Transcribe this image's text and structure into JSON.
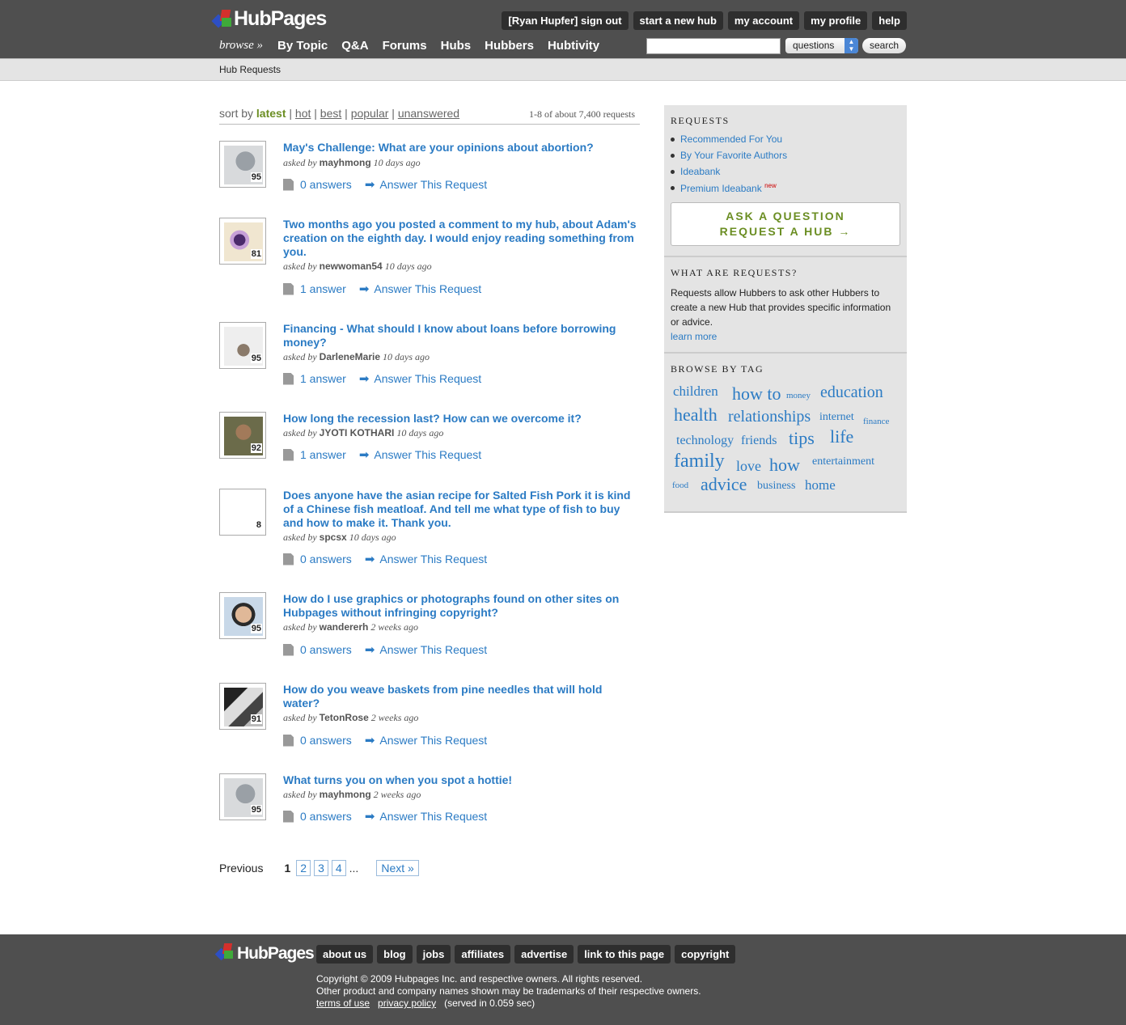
{
  "header": {
    "logo_text": "HubPages",
    "user_nav": [
      "[Ryan Hupfer] sign out",
      "start a new hub",
      "my account",
      "my profile",
      "help"
    ],
    "browse_label": "browse »",
    "main_nav": [
      "By Topic",
      "Q&A",
      "Forums",
      "Hubs",
      "Hubbers",
      "Hubtivity"
    ],
    "search": {
      "value": "",
      "select_value": "questions",
      "button_label": "search"
    }
  },
  "breadcrumb": "Hub Requests",
  "sort": {
    "prefix": "sort by",
    "current": "latest",
    "options": [
      "hot",
      "best",
      "popular",
      "unanswered"
    ],
    "count": "1-8 of about 7,400 requests"
  },
  "requests": [
    {
      "title": "May's Challenge: What are your opinions about abortion?",
      "asked_prefix": "asked by",
      "author": "mayhmong",
      "time": "10 days ago",
      "score": "95",
      "answers": "0 answers",
      "action": "Answer This Request"
    },
    {
      "title": "Two months ago you posted a comment to my hub, about Adam's creation on the eighth day. I would enjoy reading something from you.",
      "asked_prefix": "asked by",
      "author": "newwoman54",
      "time": "10 days ago",
      "score": "81",
      "answers": "1 answer",
      "action": "Answer This Request"
    },
    {
      "title": "Financing - What should I know about loans before borrowing money?",
      "asked_prefix": "asked by",
      "author": "DarleneMarie",
      "time": "10 days ago",
      "score": "95",
      "answers": "1 answer",
      "action": "Answer This Request"
    },
    {
      "title": "How long the recession last? How can we overcome it?",
      "asked_prefix": "asked by",
      "author": "JYOTI KOTHARI",
      "time": "10 days ago",
      "score": "92",
      "answers": "1 answer",
      "action": "Answer This Request"
    },
    {
      "title": "Does anyone have the asian recipe for Salted Fish Pork it is kind of a Chinese fish meatloaf. And tell me what type of fish to buy and how to make it. Thank you.",
      "asked_prefix": "asked by",
      "author": "spcsx",
      "time": "10 days ago",
      "score": "8",
      "answers": "0 answers",
      "action": "Answer This Request"
    },
    {
      "title": "How do I use graphics or photographs found on other sites on Hubpages without infringing copyright?",
      "asked_prefix": "asked by",
      "author": "wandererh",
      "time": "2 weeks ago",
      "score": "95",
      "answers": "0 answers",
      "action": "Answer This Request"
    },
    {
      "title": "How do you weave baskets from pine needles that will hold water?",
      "asked_prefix": "asked by",
      "author": "TetonRose",
      "time": "2 weeks ago",
      "score": "91",
      "answers": "0 answers",
      "action": "Answer This Request"
    },
    {
      "title": "What turns you on when you spot a hottie!",
      "asked_prefix": "asked by",
      "author": "mayhmong",
      "time": "2 weeks ago",
      "score": "95",
      "answers": "0 answers",
      "action": "Answer This Request"
    }
  ],
  "pager": {
    "previous": "Previous",
    "current": "1",
    "pages": [
      "2",
      "3",
      "4"
    ],
    "ellipsis": "...",
    "next": "Next »"
  },
  "sidebar": {
    "requests_title": "REQUESTS",
    "request_links": [
      "Recommended For You",
      "By Your Favorite Authors",
      "Ideabank",
      "Premium Ideabank"
    ],
    "new_badge": "new",
    "ask_question": "ASK A QUESTION",
    "request_hub": "REQUEST A HUB →",
    "what_title": "WHAT ARE REQUESTS?",
    "what_text": "Requests allow Hubbers to ask other Hubbers to create a new Hub that provides specific information or advice.",
    "learn_more": "learn more",
    "tags_title": "BROWSE BY TAG",
    "tags": [
      "children",
      "how to",
      "money",
      "education",
      "health",
      "relationships",
      "internet",
      "finance",
      "technology",
      "friends",
      "tips",
      "life",
      "family",
      "love",
      "how",
      "entertainment",
      "food",
      "advice",
      "business",
      "home"
    ]
  },
  "footer": {
    "logo_text": "HubPages",
    "nav": [
      "about us",
      "blog",
      "jobs",
      "affiliates",
      "advertise",
      "link to this page",
      "copyright"
    ],
    "copyright": "Copyright © 2009 Hubpages Inc. and respective owners. All rights reserved.",
    "trademark": "Other product and company names shown may be trademarks of their respective owners.",
    "terms": "terms of use",
    "privacy": "privacy policy",
    "served": "(served in 0.059 sec)"
  },
  "colors": {
    "bar": "#4f4f4f",
    "link": "#2b7bc4",
    "accent_green": "#6b8e23",
    "sidebar_bg": "#e4e4e4"
  }
}
